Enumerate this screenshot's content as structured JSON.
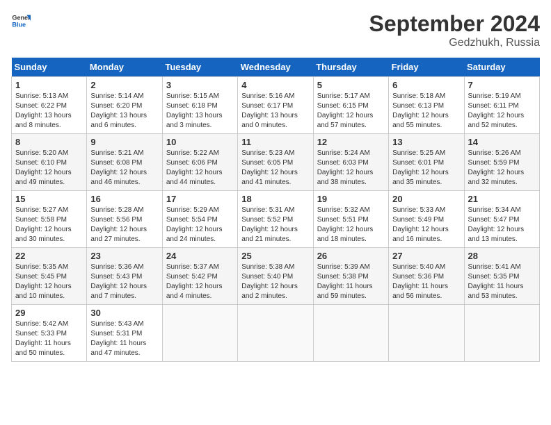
{
  "header": {
    "logo_general": "General",
    "logo_blue": "Blue",
    "month_title": "September 2024",
    "location": "Gedzhukh, Russia"
  },
  "weekdays": [
    "Sunday",
    "Monday",
    "Tuesday",
    "Wednesday",
    "Thursday",
    "Friday",
    "Saturday"
  ],
  "weeks": [
    [
      {
        "day": "1",
        "sunrise": "Sunrise: 5:13 AM",
        "sunset": "Sunset: 6:22 PM",
        "daylight": "Daylight: 13 hours and 8 minutes."
      },
      {
        "day": "2",
        "sunrise": "Sunrise: 5:14 AM",
        "sunset": "Sunset: 6:20 PM",
        "daylight": "Daylight: 13 hours and 6 minutes."
      },
      {
        "day": "3",
        "sunrise": "Sunrise: 5:15 AM",
        "sunset": "Sunset: 6:18 PM",
        "daylight": "Daylight: 13 hours and 3 minutes."
      },
      {
        "day": "4",
        "sunrise": "Sunrise: 5:16 AM",
        "sunset": "Sunset: 6:17 PM",
        "daylight": "Daylight: 13 hours and 0 minutes."
      },
      {
        "day": "5",
        "sunrise": "Sunrise: 5:17 AM",
        "sunset": "Sunset: 6:15 PM",
        "daylight": "Daylight: 12 hours and 57 minutes."
      },
      {
        "day": "6",
        "sunrise": "Sunrise: 5:18 AM",
        "sunset": "Sunset: 6:13 PM",
        "daylight": "Daylight: 12 hours and 55 minutes."
      },
      {
        "day": "7",
        "sunrise": "Sunrise: 5:19 AM",
        "sunset": "Sunset: 6:11 PM",
        "daylight": "Daylight: 12 hours and 52 minutes."
      }
    ],
    [
      {
        "day": "8",
        "sunrise": "Sunrise: 5:20 AM",
        "sunset": "Sunset: 6:10 PM",
        "daylight": "Daylight: 12 hours and 49 minutes."
      },
      {
        "day": "9",
        "sunrise": "Sunrise: 5:21 AM",
        "sunset": "Sunset: 6:08 PM",
        "daylight": "Daylight: 12 hours and 46 minutes."
      },
      {
        "day": "10",
        "sunrise": "Sunrise: 5:22 AM",
        "sunset": "Sunset: 6:06 PM",
        "daylight": "Daylight: 12 hours and 44 minutes."
      },
      {
        "day": "11",
        "sunrise": "Sunrise: 5:23 AM",
        "sunset": "Sunset: 6:05 PM",
        "daylight": "Daylight: 12 hours and 41 minutes."
      },
      {
        "day": "12",
        "sunrise": "Sunrise: 5:24 AM",
        "sunset": "Sunset: 6:03 PM",
        "daylight": "Daylight: 12 hours and 38 minutes."
      },
      {
        "day": "13",
        "sunrise": "Sunrise: 5:25 AM",
        "sunset": "Sunset: 6:01 PM",
        "daylight": "Daylight: 12 hours and 35 minutes."
      },
      {
        "day": "14",
        "sunrise": "Sunrise: 5:26 AM",
        "sunset": "Sunset: 5:59 PM",
        "daylight": "Daylight: 12 hours and 32 minutes."
      }
    ],
    [
      {
        "day": "15",
        "sunrise": "Sunrise: 5:27 AM",
        "sunset": "Sunset: 5:58 PM",
        "daylight": "Daylight: 12 hours and 30 minutes."
      },
      {
        "day": "16",
        "sunrise": "Sunrise: 5:28 AM",
        "sunset": "Sunset: 5:56 PM",
        "daylight": "Daylight: 12 hours and 27 minutes."
      },
      {
        "day": "17",
        "sunrise": "Sunrise: 5:29 AM",
        "sunset": "Sunset: 5:54 PM",
        "daylight": "Daylight: 12 hours and 24 minutes."
      },
      {
        "day": "18",
        "sunrise": "Sunrise: 5:31 AM",
        "sunset": "Sunset: 5:52 PM",
        "daylight": "Daylight: 12 hours and 21 minutes."
      },
      {
        "day": "19",
        "sunrise": "Sunrise: 5:32 AM",
        "sunset": "Sunset: 5:51 PM",
        "daylight": "Daylight: 12 hours and 18 minutes."
      },
      {
        "day": "20",
        "sunrise": "Sunrise: 5:33 AM",
        "sunset": "Sunset: 5:49 PM",
        "daylight": "Daylight: 12 hours and 16 minutes."
      },
      {
        "day": "21",
        "sunrise": "Sunrise: 5:34 AM",
        "sunset": "Sunset: 5:47 PM",
        "daylight": "Daylight: 12 hours and 13 minutes."
      }
    ],
    [
      {
        "day": "22",
        "sunrise": "Sunrise: 5:35 AM",
        "sunset": "Sunset: 5:45 PM",
        "daylight": "Daylight: 12 hours and 10 minutes."
      },
      {
        "day": "23",
        "sunrise": "Sunrise: 5:36 AM",
        "sunset": "Sunset: 5:43 PM",
        "daylight": "Daylight: 12 hours and 7 minutes."
      },
      {
        "day": "24",
        "sunrise": "Sunrise: 5:37 AM",
        "sunset": "Sunset: 5:42 PM",
        "daylight": "Daylight: 12 hours and 4 minutes."
      },
      {
        "day": "25",
        "sunrise": "Sunrise: 5:38 AM",
        "sunset": "Sunset: 5:40 PM",
        "daylight": "Daylight: 12 hours and 2 minutes."
      },
      {
        "day": "26",
        "sunrise": "Sunrise: 5:39 AM",
        "sunset": "Sunset: 5:38 PM",
        "daylight": "Daylight: 11 hours and 59 minutes."
      },
      {
        "day": "27",
        "sunrise": "Sunrise: 5:40 AM",
        "sunset": "Sunset: 5:36 PM",
        "daylight": "Daylight: 11 hours and 56 minutes."
      },
      {
        "day": "28",
        "sunrise": "Sunrise: 5:41 AM",
        "sunset": "Sunset: 5:35 PM",
        "daylight": "Daylight: 11 hours and 53 minutes."
      }
    ],
    [
      {
        "day": "29",
        "sunrise": "Sunrise: 5:42 AM",
        "sunset": "Sunset: 5:33 PM",
        "daylight": "Daylight: 11 hours and 50 minutes."
      },
      {
        "day": "30",
        "sunrise": "Sunrise: 5:43 AM",
        "sunset": "Sunset: 5:31 PM",
        "daylight": "Daylight: 11 hours and 47 minutes."
      },
      null,
      null,
      null,
      null,
      null
    ]
  ]
}
